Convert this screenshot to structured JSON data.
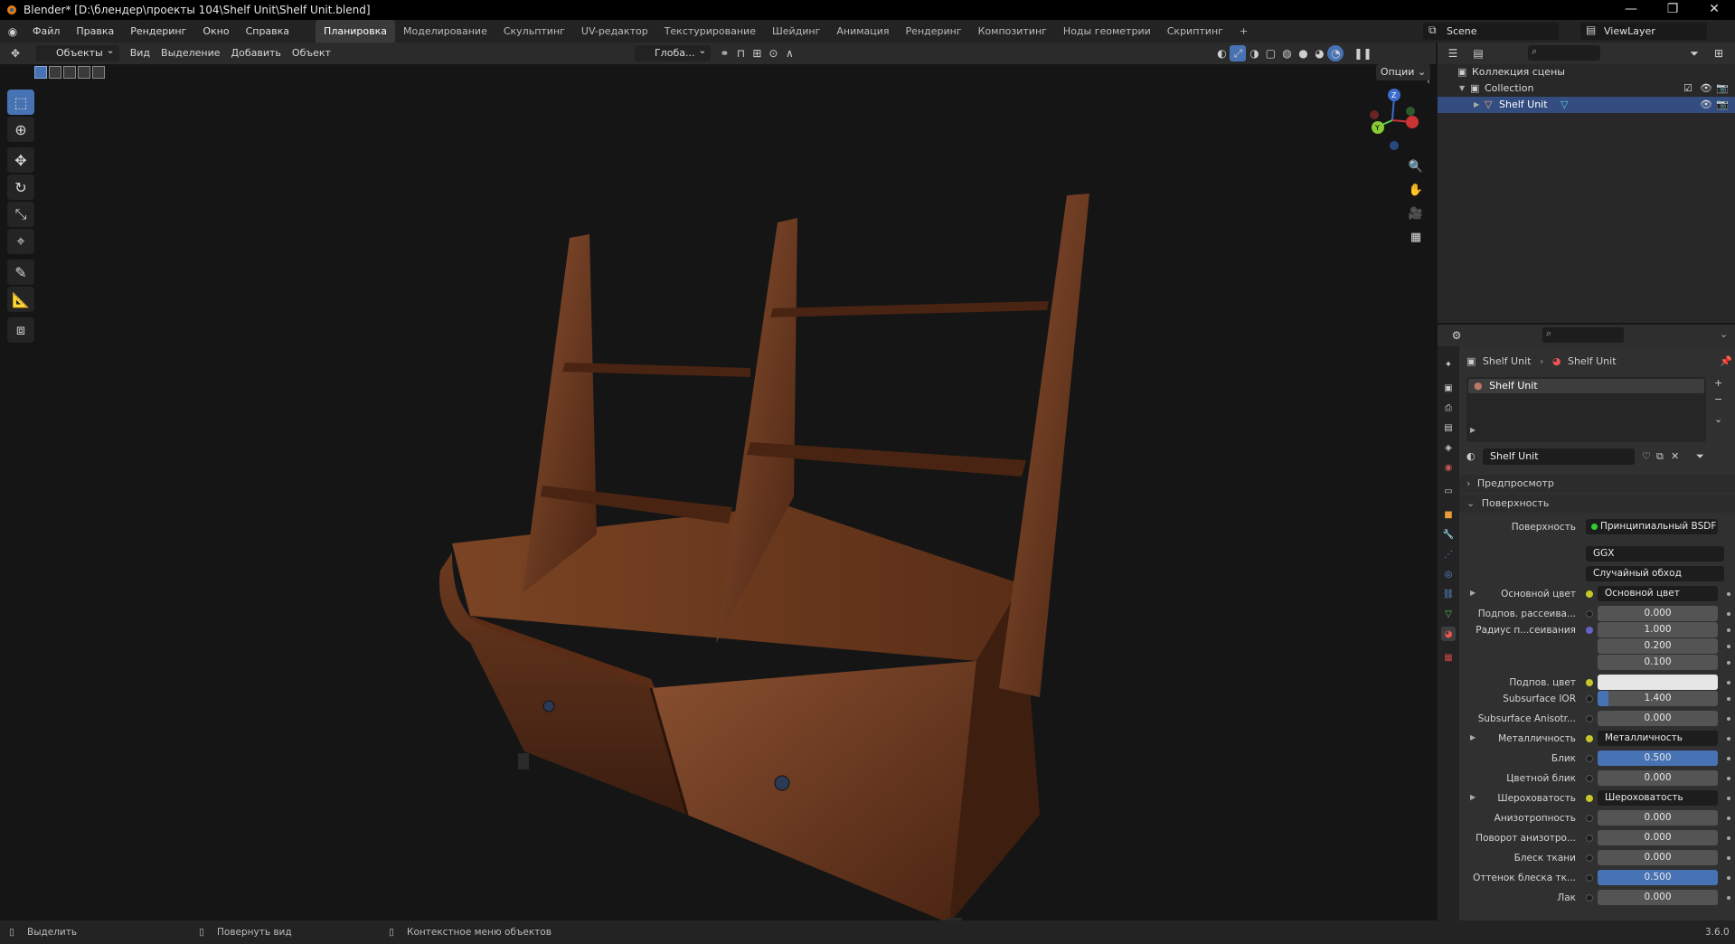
{
  "window": {
    "title": "Blender* [D:\\блендер\\проекты 104\\Shelf Unit\\Shelf Unit.blend]",
    "minimize": "—",
    "restore": "❐",
    "close": "✕"
  },
  "menu": [
    "Файл",
    "Правка",
    "Рендеринг",
    "Окно",
    "Справка"
  ],
  "workspaces": [
    "Планировка",
    "Моделирование",
    "Скульптинг",
    "UV-редактор",
    "Текстурирование",
    "Шейдинг",
    "Анимация",
    "Рендеринг",
    "Композитинг",
    "Ноды геометрии",
    "Скриптинг"
  ],
  "workspace_add": "+",
  "scene": {
    "name": "Scene",
    "view_layer": "ViewLayer"
  },
  "viewport_header": {
    "mode": "Объекты",
    "menus": [
      "Вид",
      "Выделение",
      "Добавить",
      "Объект"
    ],
    "transform": "Глоба...",
    "options": "Опции"
  },
  "outliner": {
    "scene_collection": "Коллекция сцены",
    "collection": "Collection",
    "object": "Shelf Unit"
  },
  "properties": {
    "breadcrumb": [
      "Shelf Unit",
      "Shelf Unit"
    ],
    "slot": "Shelf Unit",
    "material": "Shelf Unit",
    "panel_preview": "Предпросмотр",
    "panel_surface": "Поверхность",
    "surface_label": "Поверхность",
    "surface_value": "Принципиальный BSDF",
    "distribution": "GGX",
    "subsurface_method": "Случайный обход",
    "rows": [
      {
        "label": "Основной цвет",
        "value": "Основной цвет",
        "type": "link"
      },
      {
        "label": "Подпов. рассеива...",
        "value": "0.000",
        "type": "num"
      },
      {
        "label": "Радиус п...сеивания",
        "value": "1.000",
        "type": "num"
      },
      {
        "label": "",
        "value": "0.200",
        "type": "num"
      },
      {
        "label": "",
        "value": "0.100",
        "type": "num"
      },
      {
        "label": "Подпов. цвет",
        "value": "",
        "type": "color"
      },
      {
        "label": "Subsurface IOR",
        "value": "1.400",
        "type": "num"
      },
      {
        "label": "Subsurface Anisotr...",
        "value": "0.000",
        "type": "num"
      },
      {
        "label": "Металличность",
        "value": "Металличность",
        "type": "link"
      },
      {
        "label": "Блик",
        "value": "0.500",
        "type": "blue"
      },
      {
        "label": "Цветной блик",
        "value": "0.000",
        "type": "num"
      },
      {
        "label": "Шероховатость",
        "value": "Шероховатость",
        "type": "link"
      },
      {
        "label": "Анизотропность",
        "value": "0.000",
        "type": "num"
      },
      {
        "label": "Поворот анизотро...",
        "value": "0.000",
        "type": "num"
      },
      {
        "label": "Блеск ткани",
        "value": "0.000",
        "type": "num"
      },
      {
        "label": "Оттенок блеска тк...",
        "value": "0.500",
        "type": "blue"
      },
      {
        "label": "Лак",
        "value": "0.000",
        "type": "num"
      }
    ]
  },
  "statusbar": {
    "select": "Выделить",
    "rotate": "Повернуть вид",
    "context": "Контекстное меню объектов",
    "version": "3.6.0"
  },
  "colors": {
    "accent": "#4772b3",
    "wood_dark": "#3b1d10",
    "wood_mid": "#6b3a1f",
    "wood_light": "#8a5030"
  }
}
